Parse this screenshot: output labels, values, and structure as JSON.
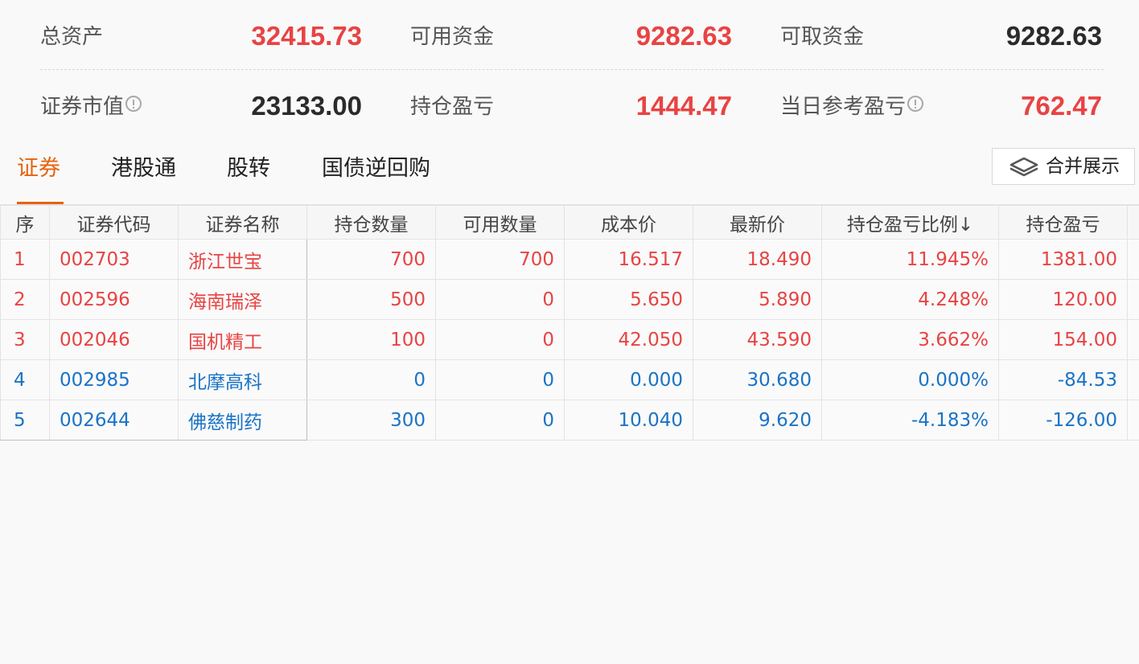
{
  "summary": {
    "total_assets": {
      "label": "总资产",
      "value": "32415.73"
    },
    "available_funds": {
      "label": "可用资金",
      "value": "9282.63"
    },
    "withdrawable_funds": {
      "label": "可取资金",
      "value": "9282.63"
    },
    "market_value": {
      "label": "证券市值",
      "value": "23133.00"
    },
    "position_pnl": {
      "label": "持仓盈亏",
      "value": "1444.47"
    },
    "daily_pnl": {
      "label": "当日参考盈亏",
      "value": "762.47"
    }
  },
  "tabs": [
    {
      "label": "证券",
      "active": true
    },
    {
      "label": "港股通",
      "active": false
    },
    {
      "label": "股转",
      "active": false
    },
    {
      "label": "国债逆回购",
      "active": false
    }
  ],
  "merge_button": {
    "label": "合并展示",
    "icon": "layers-icon"
  },
  "table": {
    "columns": [
      "序",
      "证券代码",
      "证券名称",
      "持仓数量",
      "可用数量",
      "成本价",
      "最新价",
      "持仓盈亏比例↓",
      "持仓盈亏"
    ],
    "rows": [
      {
        "idx": "1",
        "code": "002703",
        "name": "浙江世宝",
        "qty": "700",
        "avail": "700",
        "cost": "16.517",
        "last": "18.490",
        "ratio": "11.945%",
        "pnl": "1381.00",
        "trend": "up"
      },
      {
        "idx": "2",
        "code": "002596",
        "name": "海南瑞泽",
        "qty": "500",
        "avail": "0",
        "cost": "5.650",
        "last": "5.890",
        "ratio": "4.248%",
        "pnl": "120.00",
        "trend": "up"
      },
      {
        "idx": "3",
        "code": "002046",
        "name": "国机精工",
        "qty": "100",
        "avail": "0",
        "cost": "42.050",
        "last": "43.590",
        "ratio": "3.662%",
        "pnl": "154.00",
        "trend": "up"
      },
      {
        "idx": "4",
        "code": "002985",
        "name": "北摩高科",
        "qty": "0",
        "avail": "0",
        "cost": "0.000",
        "last": "30.680",
        "ratio": "0.000%",
        "pnl": "-84.53",
        "trend": "down"
      },
      {
        "idx": "5",
        "code": "002644",
        "name": "佛慈制药",
        "qty": "300",
        "avail": "0",
        "cost": "10.040",
        "last": "9.620",
        "ratio": "-4.183%",
        "pnl": "-126.00",
        "trend": "down"
      }
    ]
  },
  "colors": {
    "up": "#e84343",
    "down": "#1a73c6",
    "accent": "#e8620f",
    "neutral_value": "#2b2b2b"
  }
}
